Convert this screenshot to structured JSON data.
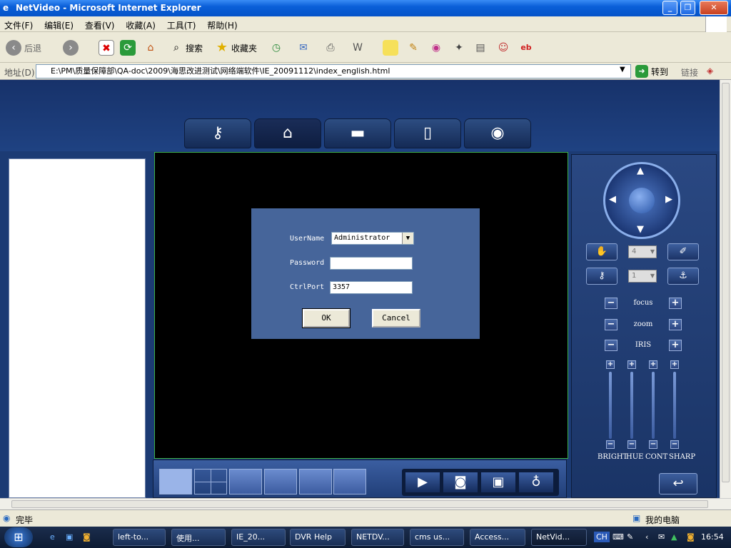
{
  "window": {
    "title": "NetVideo - Microsoft Internet Explorer"
  },
  "menu": [
    "文件(F)",
    "编辑(E)",
    "查看(V)",
    "收藏(A)",
    "工具(T)",
    "帮助(H)"
  ],
  "toolbar": {
    "back": "后退",
    "search": "搜索",
    "favorites": "收藏夹"
  },
  "address": {
    "label": "地址(D)",
    "url": "E:\\PM\\质量保障部\\QA-doc\\2009\\海思改进测试\\网络端软件\\IE_20091112\\index_english.html",
    "go": "转到",
    "links": "链接"
  },
  "login": {
    "username_label": "UserName",
    "username_value": "Administrator",
    "password_label": "Password",
    "password_value": "",
    "ctrlport_label": "CtrlPort",
    "ctrlport_value": "3357",
    "ok": "OK",
    "cancel": "Cancel"
  },
  "ptz": {
    "preset_value": "4",
    "speed_value": "1",
    "focus": "focus",
    "zoom": "zoom",
    "iris": "IRIS",
    "sliders": [
      "BRIGHT",
      "HUE",
      "CONT",
      "SHARP"
    ]
  },
  "status": {
    "left": "完毕",
    "right": "我的电脑"
  },
  "taskbar": {
    "items": [
      "left-to...",
      "使用...",
      "IE_20...",
      "DVR Help",
      "NETDV...",
      "cms us...",
      "Access...",
      "NetVid..."
    ],
    "lang": "CH",
    "time": "16:54"
  },
  "colors": {
    "accent": "#1c3b74",
    "video_border": "#3db04a",
    "dialog": "#46659a"
  }
}
